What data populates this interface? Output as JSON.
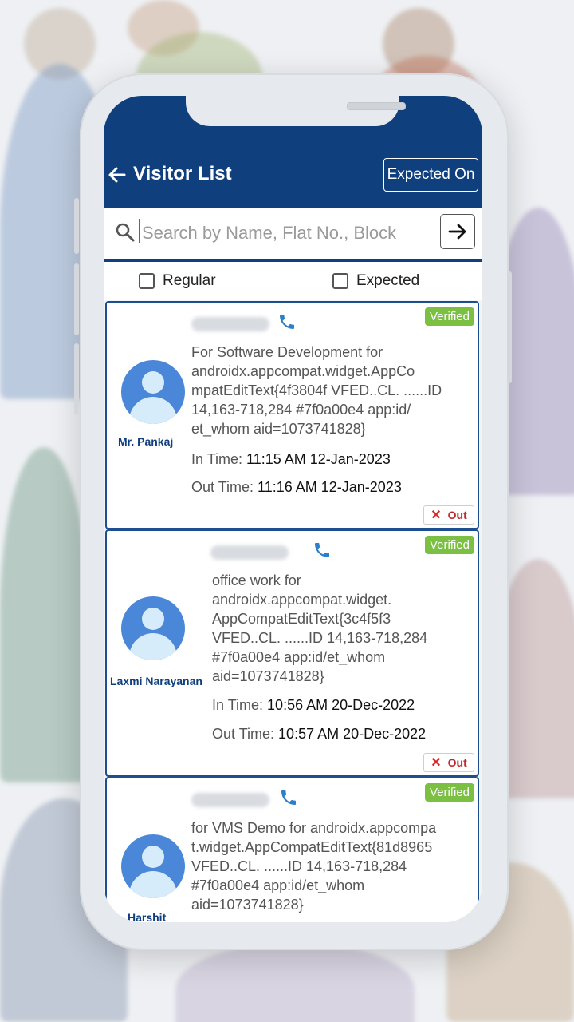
{
  "header": {
    "title": "Visitor List",
    "expected_on_label": "Expected On"
  },
  "search": {
    "placeholder": "Search by Name, Flat No., Block..."
  },
  "filters": {
    "regular_label": "Regular",
    "expected_label": "Expected"
  },
  "colors": {
    "primary": "#0f3f7d",
    "verified": "#7bc043",
    "out_red": "#e02424"
  },
  "visitors": [
    {
      "name": "Mr. Pankaj",
      "badge": "Verified",
      "purpose_lines": [
        "For Software Development  for",
        "androidx.appcompat.widget.AppCo",
        "mpatEditText{4f3804f VFED..CL. ......ID",
        "14,163-718,284 #7f0a00e4 app:id/",
        "et_whom aid=1073741828}"
      ],
      "in_label": "In Time:",
      "in_time": "11:15 AM 12-Jan-2023",
      "out_label": "Out Time:",
      "out_time": "11:16 AM 12-Jan-2023",
      "out_button": "Out"
    },
    {
      "name": "Laxmi Narayanan",
      "badge": "Verified",
      "purpose_lines": [
        "office work for",
        "androidx.appcompat.widget.",
        "AppCompatEditText{3c4f5f3",
        "VFED..CL. ......ID 14,163-718,284",
        "#7f0a00e4 app:id/et_whom",
        "aid=1073741828}"
      ],
      "in_label": "In Time:",
      "in_time": "10:56 AM 20-Dec-2022",
      "out_label": "Out Time:",
      "out_time": "10:57 AM 20-Dec-2022",
      "out_button": "Out"
    },
    {
      "name": "Harshit",
      "badge": "Verified",
      "purpose_lines": [
        "for VMS Demo for androidx.appcompa",
        "t.widget.AppCompatEditText{81d8965",
        "VFED..CL. ......ID 14,163-718,284",
        "#7f0a00e4 app:id/et_whom",
        "aid=1073741828}"
      ]
    }
  ]
}
